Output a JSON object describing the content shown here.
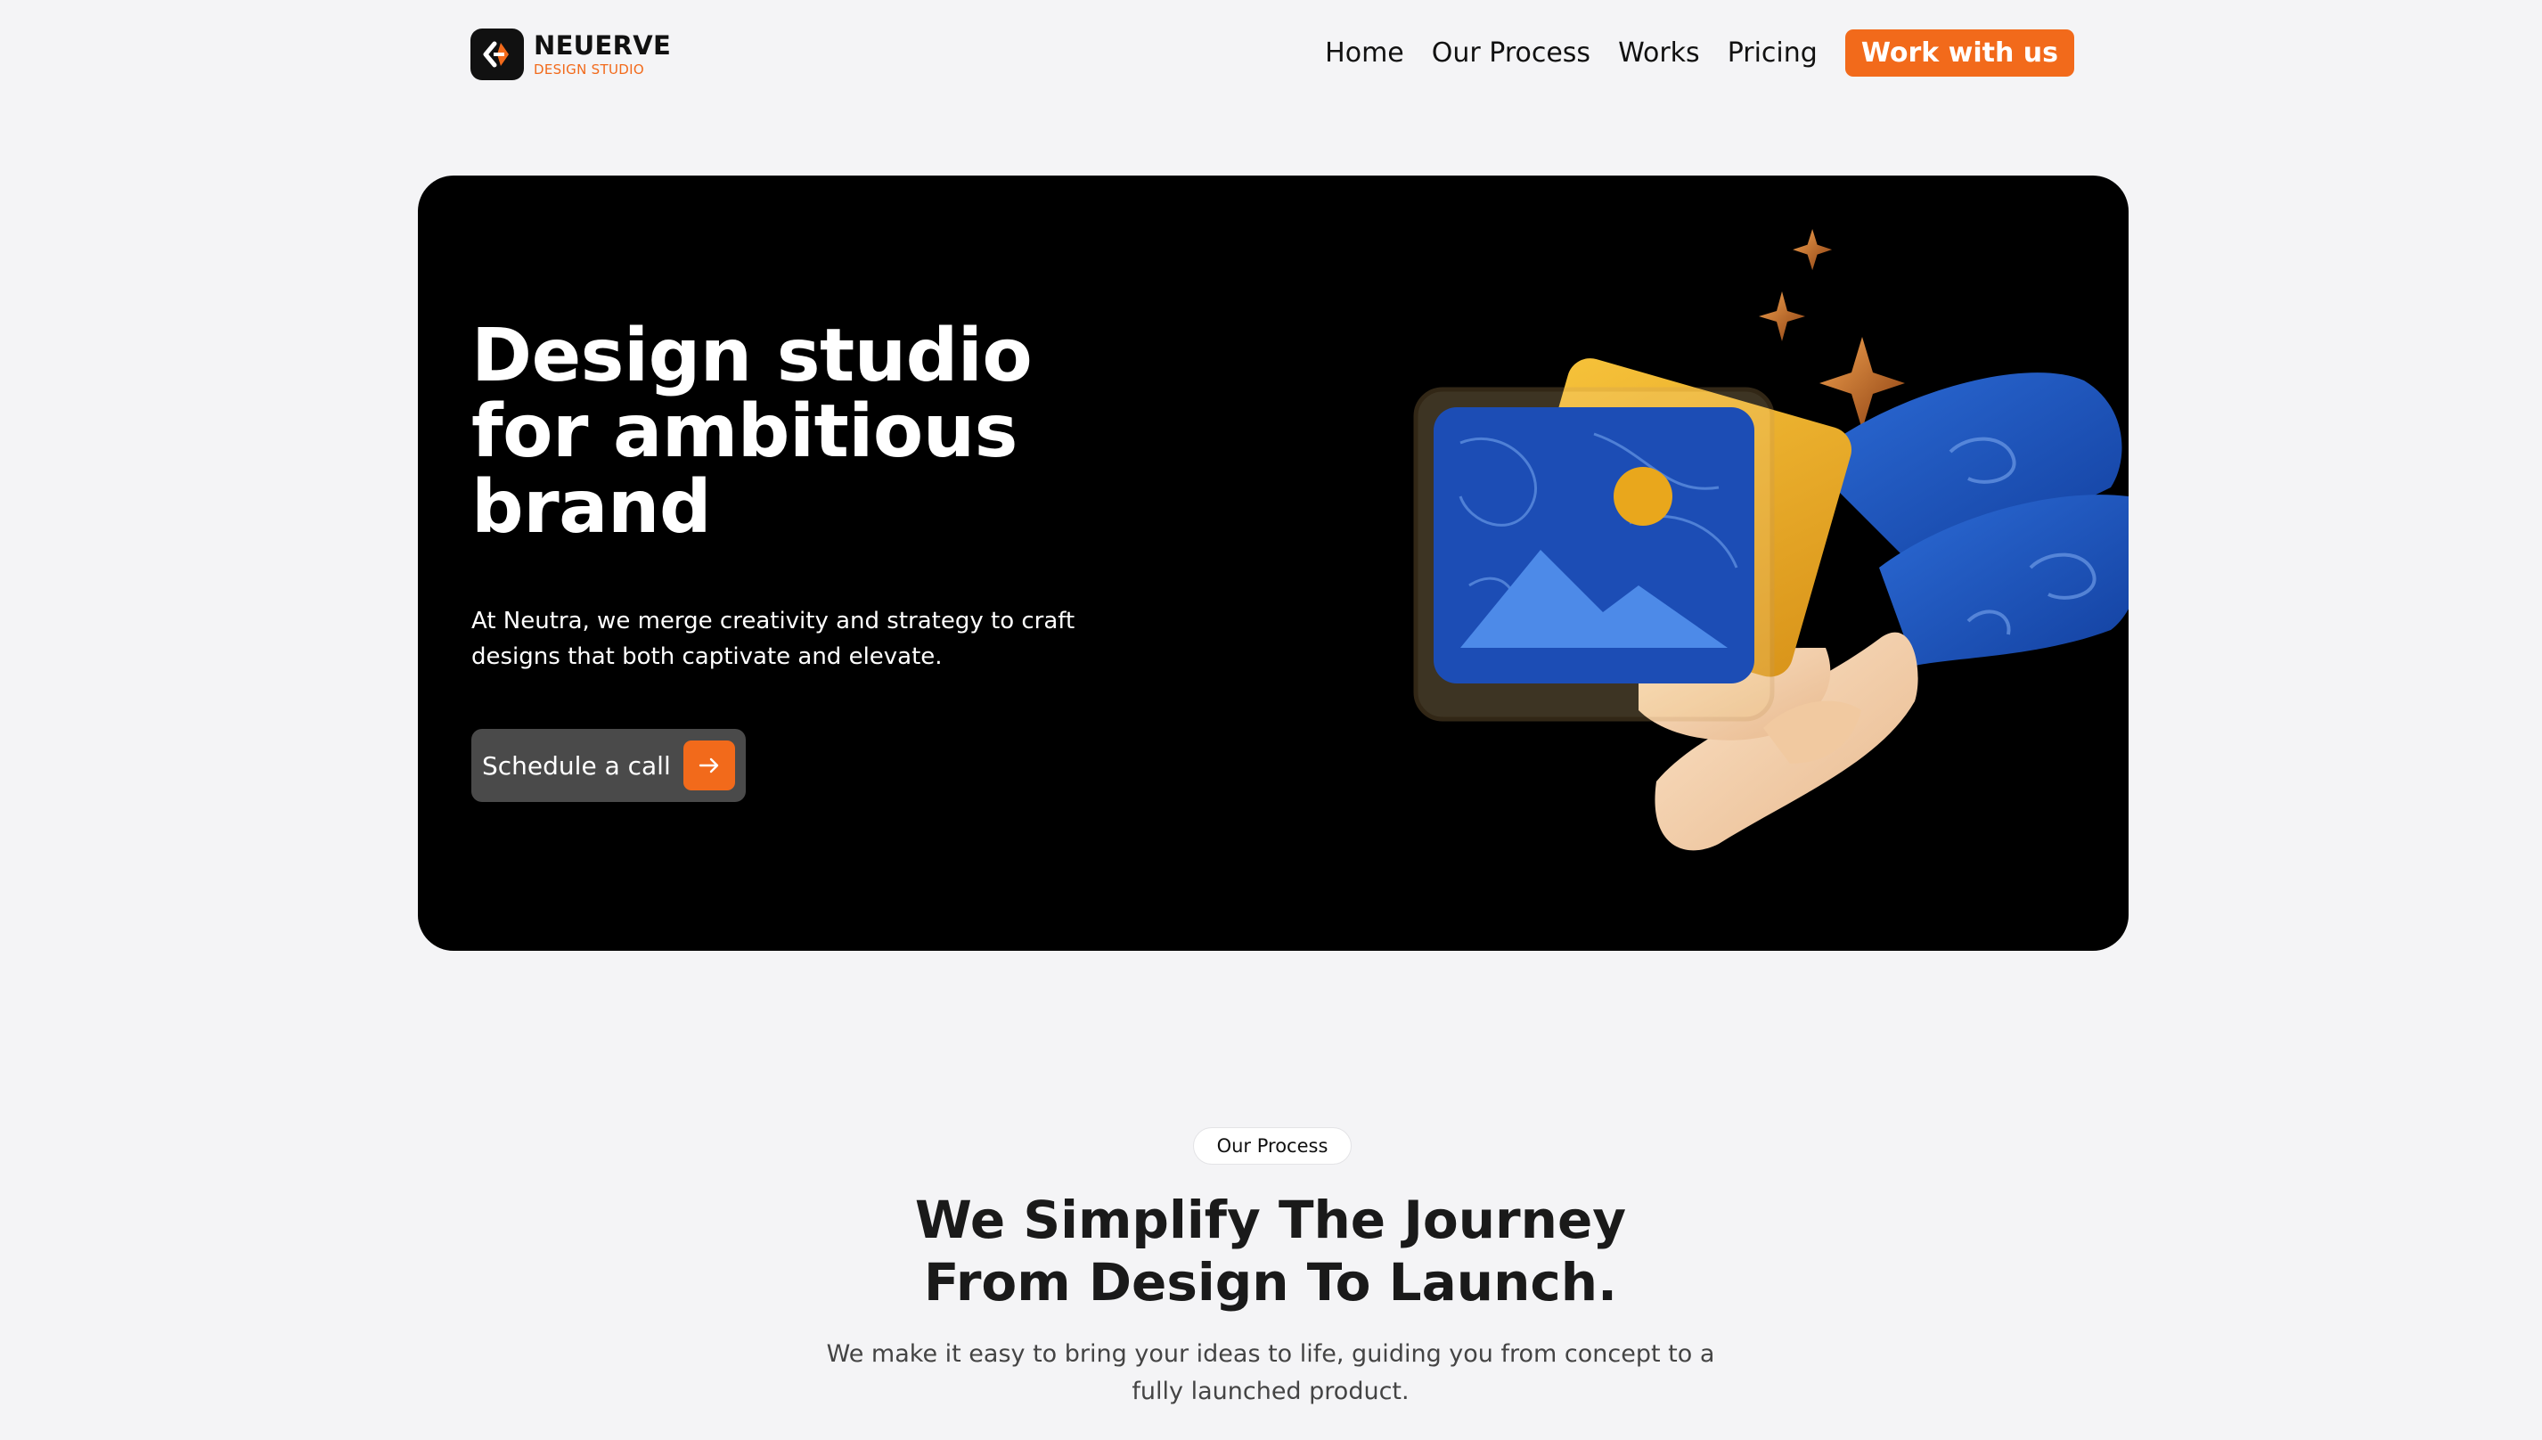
{
  "colors": {
    "accent": "#f26a1b",
    "hero_bg": "#000000",
    "page_bg": "#f4f4f6"
  },
  "nav": {
    "logo": {
      "name": "NEUERVE",
      "tagline": "DESIGN STUDIO",
      "icon": "logo-chevron-mark"
    },
    "links": [
      {
        "label": "Home"
      },
      {
        "label": "Our Process"
      },
      {
        "label": "Works"
      },
      {
        "label": "Pricing"
      }
    ],
    "cta_label": "Work with us"
  },
  "hero": {
    "title_lines": [
      "Design studio",
      "for ambitious",
      "brand"
    ],
    "description": "At Neutra, we merge creativity and strategy to craft designs that both captivate and elevate.",
    "button_label": "Schedule a call",
    "button_icon": "arrow-right-icon",
    "illustration": "3d-hand-holding-image-icon"
  },
  "process": {
    "pill_label": "Our Process",
    "title_lines": [
      "We Simplify The Journey",
      "From Design To Launch."
    ],
    "description": "We make it easy to bring your ideas to life, guiding you from concept to a fully launched product."
  }
}
